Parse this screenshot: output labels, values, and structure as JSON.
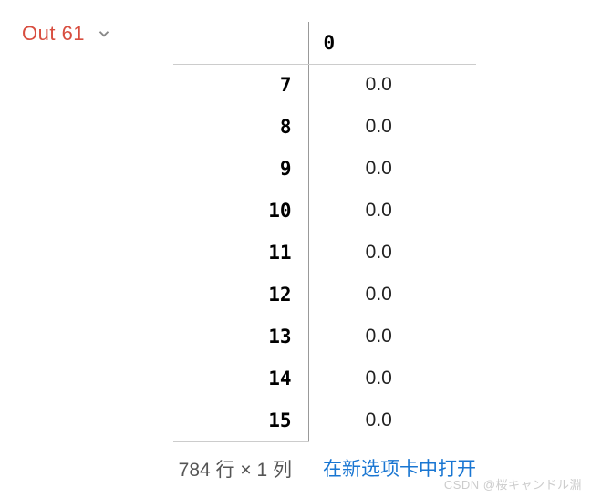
{
  "output": {
    "label": "Out 61"
  },
  "table": {
    "column_header": "0",
    "rows": [
      {
        "index": "7",
        "value": "0.0"
      },
      {
        "index": "8",
        "value": "0.0"
      },
      {
        "index": "9",
        "value": "0.0"
      },
      {
        "index": "10",
        "value": "0.0"
      },
      {
        "index": "11",
        "value": "0.0"
      },
      {
        "index": "12",
        "value": "0.0"
      },
      {
        "index": "13",
        "value": "0.0"
      },
      {
        "index": "14",
        "value": "0.0"
      },
      {
        "index": "15",
        "value": "0.0"
      }
    ],
    "shape_info": "784 行 × 1 列",
    "open_link": "在新选项卡中打开"
  },
  "watermark": "CSDN @桜キャンドル淵"
}
